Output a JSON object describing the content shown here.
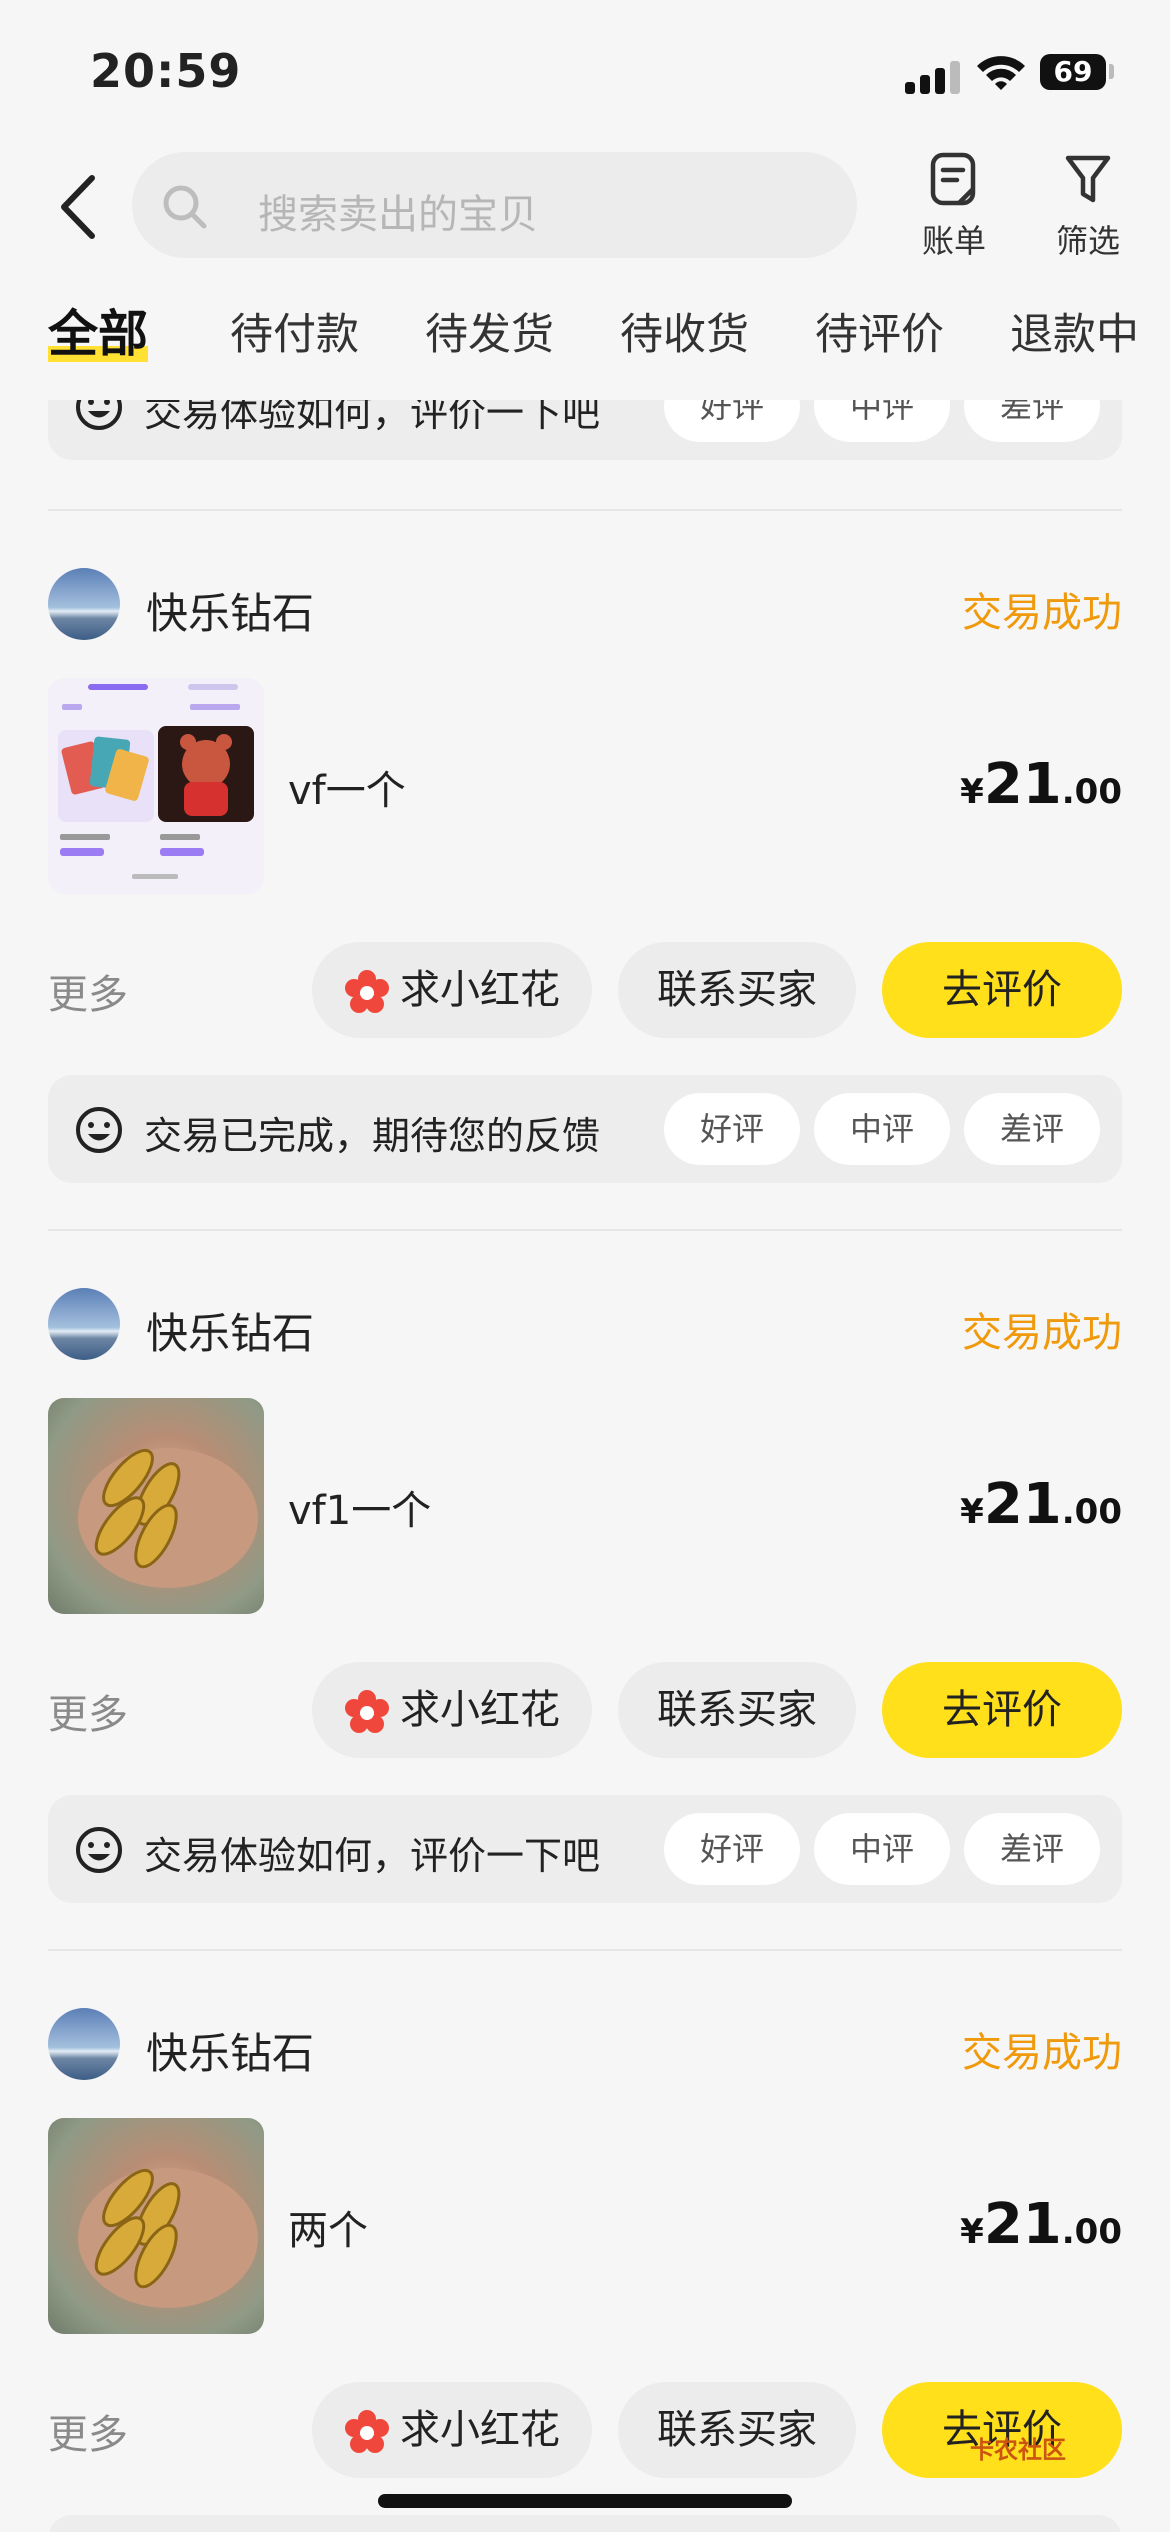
{
  "status_bar": {
    "time": "20:59",
    "battery": "69"
  },
  "search": {
    "placeholder": "搜索卖出的宝贝"
  },
  "toolbar": {
    "bill_label": "账单",
    "filter_label": "筛选"
  },
  "tabs": [
    {
      "label": "全部",
      "active": true
    },
    {
      "label": "待付款"
    },
    {
      "label": "待发货"
    },
    {
      "label": "待收货"
    },
    {
      "label": "待评价"
    },
    {
      "label": "退款中"
    }
  ],
  "partial_feedback": {
    "text": "交易体验如何，评价一下吧",
    "good": "好评",
    "neutral": "中评",
    "bad": "差评"
  },
  "orders": [
    {
      "seller": "快乐钻石",
      "status": "交易成功",
      "title": "vf一个",
      "price_symbol": "¥",
      "price_int": "21",
      "price_dec": ".00",
      "more": "更多",
      "flower_btn": "求小红花",
      "contact_btn": "联系买家",
      "review_btn": "去评价",
      "feedback": {
        "text": "交易已完成，期待您的反馈",
        "good": "好评",
        "neutral": "中评",
        "bad": "差评"
      }
    },
    {
      "seller": "快乐钻石",
      "status": "交易成功",
      "title": "vf1一个",
      "price_symbol": "¥",
      "price_int": "21",
      "price_dec": ".00",
      "more": "更多",
      "flower_btn": "求小红花",
      "contact_btn": "联系买家",
      "review_btn": "去评价",
      "feedback": {
        "text": "交易体验如何，评价一下吧",
        "good": "好评",
        "neutral": "中评",
        "bad": "差评"
      }
    },
    {
      "seller": "快乐钻石",
      "status": "交易成功",
      "title": "两个",
      "price_symbol": "¥",
      "price_int": "21",
      "price_dec": ".00",
      "more": "更多",
      "flower_btn": "求小红花",
      "contact_btn": "联系买家",
      "review_btn": "去评价"
    }
  ],
  "watermark": "卡农社区",
  "colors": {
    "accent_yellow": "#ffe01a",
    "status_orange": "#ef9a0c",
    "flower_red": "#f0473c"
  }
}
